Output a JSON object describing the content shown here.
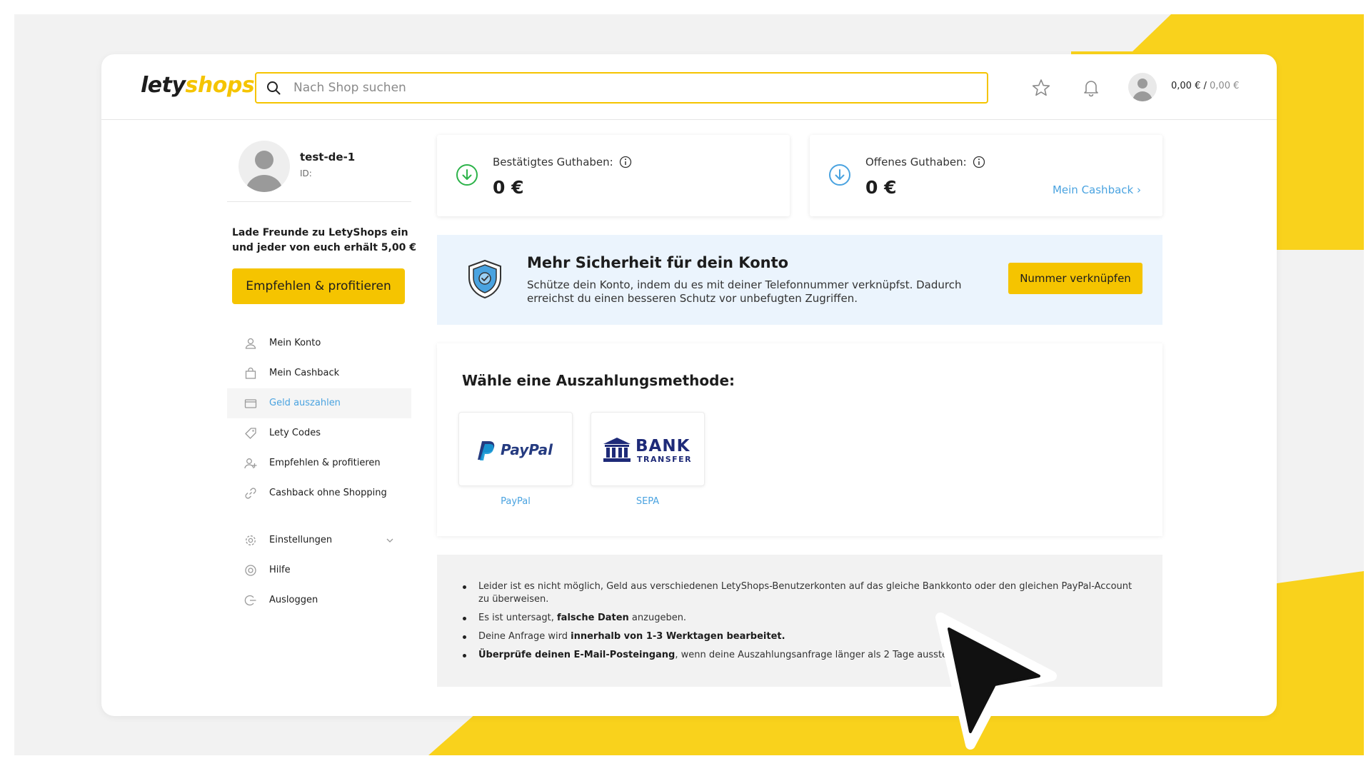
{
  "colors": {
    "brand_yellow": "#f5c400",
    "link_blue": "#4aa3e0",
    "confirm_green": "#2db34a",
    "banner_bg": "#ebf4fd"
  },
  "header": {
    "logo_dark": "lety",
    "logo_yellow": "shops",
    "search_placeholder": "Nach Shop suchen",
    "confirmed_balance": "0,00 €",
    "separator": "/",
    "pending_balance": "0,00 €",
    "icons": [
      "star-icon",
      "bell-icon",
      "avatar"
    ]
  },
  "profile": {
    "name": "test-de-1",
    "id_label": "ID:"
  },
  "invite": {
    "text": "Lade Freunde zu LetyShops ein und jeder von euch erhält 5,00 €",
    "button": "Empfehlen & profitieren"
  },
  "nav": {
    "items": [
      {
        "label": "Mein Konto",
        "icon": "user-icon"
      },
      {
        "label": "Mein Cashback",
        "icon": "shopping-bag-icon"
      },
      {
        "label": "Geld auszahlen",
        "icon": "wallet-icon",
        "active": true
      },
      {
        "label": "Lety Codes",
        "icon": "tag-icon"
      },
      {
        "label": "Empfehlen & profitieren",
        "icon": "add-user-icon"
      },
      {
        "label": "Cashback ohne Shopping",
        "icon": "link-icon"
      },
      {
        "label": "Einstellungen",
        "icon": "gear-icon"
      },
      {
        "label": "Hilfe",
        "icon": "help-icon"
      },
      {
        "label": "Ausloggen",
        "icon": "logout-icon"
      }
    ]
  },
  "balances": {
    "confirmed": {
      "label": "Bestätigtes Guthaben:",
      "value": "0 €"
    },
    "pending": {
      "label": "Offenes Guthaben:",
      "value": "0 €",
      "link": "Mein Cashback"
    }
  },
  "security": {
    "title": "Mehr Sicherheit für dein Konto",
    "description": "Schütze dein Konto, indem du es mit deiner Telefonnummer verknüpfst. Dadurch erreichst du einen besseren Schutz vor unbefugten Zugriffen.",
    "button": "Nummer verknüpfen"
  },
  "payout": {
    "title": "Wähle eine Auszahlungsmethode:",
    "methods": [
      {
        "logo_text": "PayPal",
        "label": "PayPal"
      },
      {
        "logo_text_1": "BANK",
        "logo_text_2": "TRANSFER",
        "label": "SEPA"
      }
    ]
  },
  "info": {
    "items": [
      {
        "pre": "Leider ist es nicht möglich, Geld aus verschiedenen LetyShops-Benutzerkonten auf das gleiche Bankkonto oder den gleichen PayPal-Account zu überweisen.",
        "bold": "",
        "post": ""
      },
      {
        "pre": "Es ist untersagt, ",
        "bold": "falsche Daten",
        "post": " anzugeben."
      },
      {
        "pre": "Deine Anfrage wird ",
        "bold": "innerhalb von 1-3 Werktagen bearbeitet.",
        "post": ""
      },
      {
        "pre": "",
        "bold": "Überprüfe deinen E-Mail-Posteingang",
        "post": ", wenn deine Auszahlungsanfrage länger als 2 Tage aussteht."
      }
    ]
  }
}
